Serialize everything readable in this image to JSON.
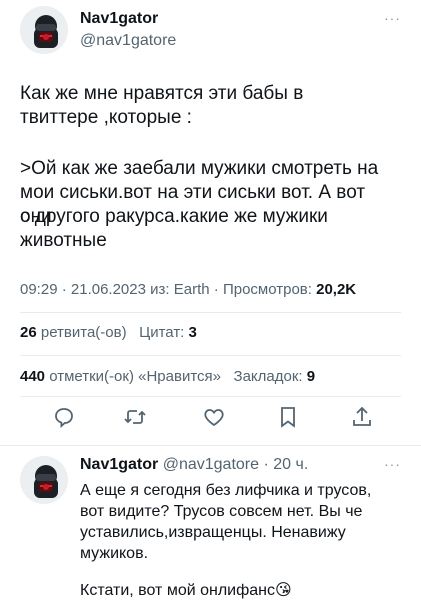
{
  "tweet": {
    "author_name": "Nav1gator",
    "author_handle": "@nav1gatore",
    "text_line1": "Как же мне нравятся эти бабы в",
    "text_line2": "твиттере ,которые :",
    "quote_line1": ">Ой как же заебали мужики смотреть на",
    "quote_line2": "мои сиськи.вот на эти сиськи вот. А вот они",
    "quote_line3": "с другого ракурса.какие же мужики",
    "quote_line4": "животные",
    "time": "09:29",
    "date": "21.06.2023",
    "source_prefix": "из:",
    "source": "Earth",
    "views_label": "Просмотров:",
    "views_count": "20,2K",
    "retweets_count": "26",
    "retweets_label": "ретвита(-ов)",
    "quotes_label": "Цитат:",
    "quotes_count": "3",
    "likes_count": "440",
    "likes_label": "отметки(-ок) «Нравится»",
    "bookmarks_label": "Закладок:",
    "bookmarks_count": "9",
    "more": "···"
  },
  "actions": [
    {
      "icon": "reply-icon"
    },
    {
      "icon": "retweet-icon"
    },
    {
      "icon": "like-icon"
    },
    {
      "icon": "bookmark-icon"
    },
    {
      "icon": "share-icon"
    }
  ],
  "reply": {
    "author_name": "Nav1gator",
    "author_handle": "@nav1gatore",
    "time_ago": "20 ч.",
    "more": "···",
    "line1": "А еще я сегодня без лифчика и трусов,",
    "line2": "вот видите? Трусов совсем нет. Вы че",
    "line3": "уставились,извращенцы. Ненавижу",
    "line4": "мужиков.",
    "line5": "Кстати, вот мой онлифанс",
    "emoji": "😘"
  },
  "colors": {
    "text": "#0f1419",
    "secondary": "#536471",
    "divider": "#e6ecf0",
    "icon": "#536471"
  }
}
